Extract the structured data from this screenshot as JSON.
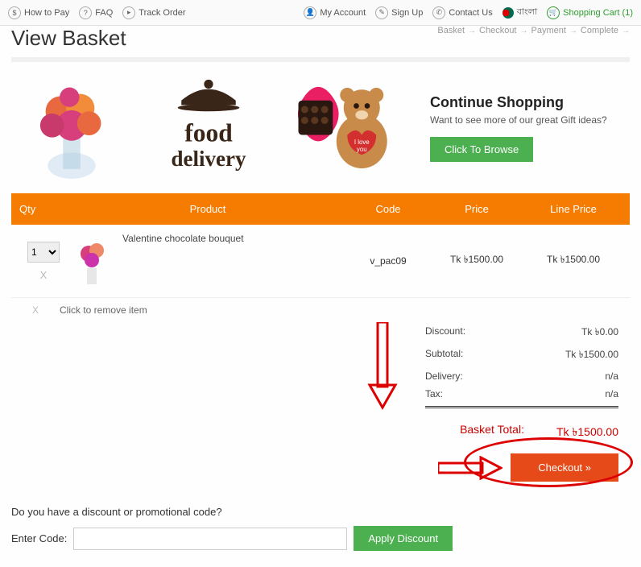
{
  "topbar": {
    "left": {
      "howtopay": "How to Pay",
      "faq": "FAQ",
      "track": "Track Order"
    },
    "right": {
      "myaccount": "My Account",
      "signup": "Sign Up",
      "contact": "Contact Us",
      "lang": "বাংলা",
      "cart": "Shopping Cart  (1)"
    }
  },
  "header": {
    "title": "View Basket",
    "breadcrumb": {
      "step1": "Basket",
      "step2": "Checkout",
      "step3": "Payment",
      "step4": "Complete"
    }
  },
  "promo": {
    "title": "Continue Shopping",
    "subtitle": "Want to see more of our great Gift ideas?",
    "button": "Click To Browse"
  },
  "table": {
    "headers": {
      "qty": "Qty",
      "product": "Product",
      "code": "Code",
      "price": "Price",
      "line": "Line Price"
    },
    "row": {
      "qty_value": "1",
      "name": "Valentine chocolate bouquet",
      "code": "v_pac09",
      "price": "Tk ৳1500.00",
      "line": "Tk ৳1500.00"
    },
    "remove_label": "Click to remove item",
    "remove_x": "X"
  },
  "totals": {
    "discount_label": "Discount:",
    "discount_value": "Tk ৳0.00",
    "subtotal_label": "Subtotal:",
    "subtotal_value": "Tk ৳1500.00",
    "delivery_label": "Delivery:",
    "delivery_value": "n/a",
    "tax_label": "Tax:",
    "tax_value": "n/a",
    "basket_total_label": "Basket Total:",
    "basket_total_value": "Tk ৳1500.00"
  },
  "checkout_button": "Checkout »",
  "discount": {
    "question": "Do you have a discount or promotional code?",
    "label": "Enter Code:",
    "apply": "Apply Discount"
  }
}
